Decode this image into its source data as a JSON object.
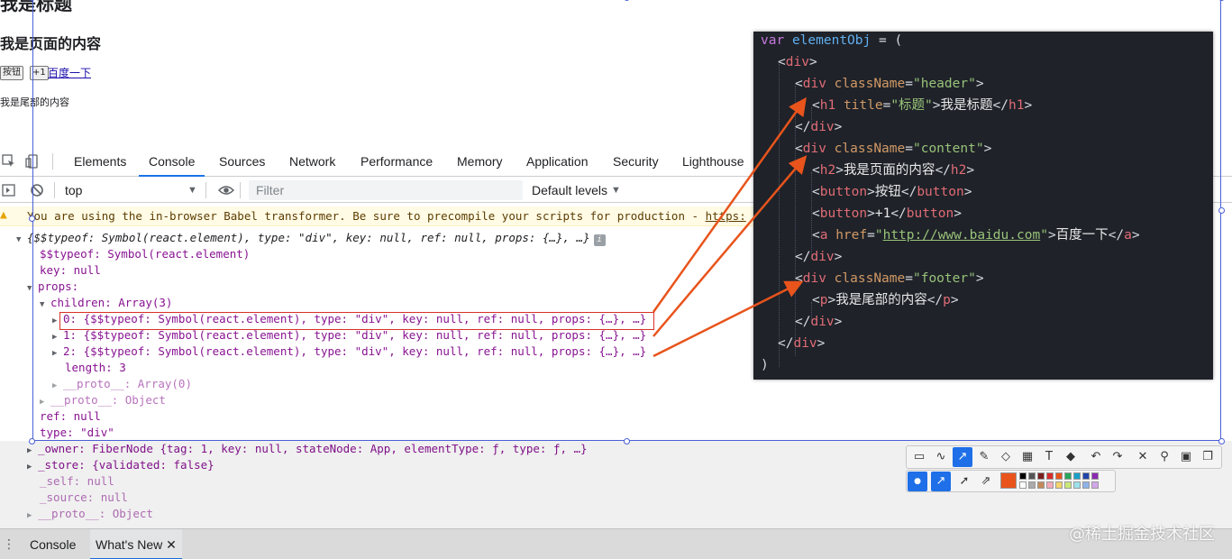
{
  "page": {
    "h1": "我是标题",
    "h2": "我是页面的内容",
    "btn1": "按钮",
    "btn2": "+1",
    "link": "百度一下",
    "footer_p": "我是尾部的内容"
  },
  "devtools": {
    "tabs": [
      "Elements",
      "Console",
      "Sources",
      "Network",
      "Performance",
      "Memory",
      "Application",
      "Security",
      "Lighthouse"
    ],
    "context": "top",
    "filter_placeholder": "Filter",
    "levels": "Default levels",
    "warning": "You are using the in-browser Babel transformer. Be sure to precompile your scripts for production - ",
    "warning_link": "https:",
    "console_lines": {
      "l0": "{$$typeof: Symbol(react.element), type: \"div\", key: null, ref: null, props: {…}, …}",
      "l1": "$$typeof: Symbol(react.element)",
      "l2": "key: null",
      "l3": "props:",
      "l4": "children: Array(3)",
      "l5": "0: {$$typeof: Symbol(react.element), type: \"div\", key: null, ref: null, props: {…}, …}",
      "l6": "1: {$$typeof: Symbol(react.element), type: \"div\", key: null, ref: null, props: {…}, …}",
      "l7": "2: {$$typeof: Symbol(react.element), type: \"div\", key: null, ref: null, props: {…}, …}",
      "l8": "length: 3",
      "l9": "__proto__: Array(0)",
      "l10": "__proto__: Object",
      "l11": "ref: null",
      "l12": "type: \"div\"",
      "l13": "_owner: FiberNode {tag: 1, key: null, stateNode: App, elementType: ƒ, type: ƒ, …}",
      "l14": "_store: {validated: false}",
      "l15": "_self: null",
      "l16": "_source: null",
      "l17": "__proto__: Object"
    },
    "drawer_tabs": [
      "Console",
      "What's New"
    ]
  },
  "code": {
    "l1_kw": "var",
    "l1_var": "elementObj",
    "l1_rest": " = (",
    "title_attr_val": "\"标题\"",
    "h1_text": "我是标题",
    "h2_text": "我是页面的内容",
    "btn1_text": "按钮",
    "btn2_text": "+1",
    "href": "http://www.baidu.com",
    "a_text": "百度一下",
    "p_text": "我是尾部的内容",
    "close_paren": ")",
    "header_cls": "\"header\"",
    "content_cls": "\"content\"",
    "footer_cls": "\"footer\""
  },
  "colors": {
    "accent": "#1a73e8",
    "selection": "#4a5fd6",
    "arrow": "#e8541c",
    "code_bg": "#1f2229"
  },
  "watermark": "@稀土掘金技术社区"
}
